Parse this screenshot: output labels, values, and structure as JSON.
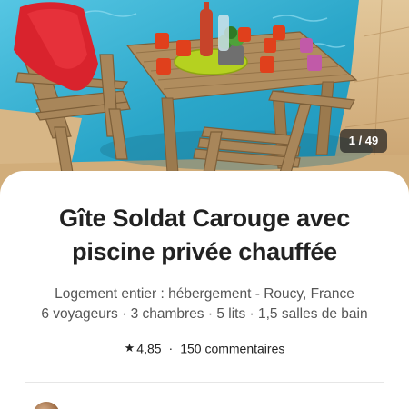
{
  "gallery": {
    "counter": "1 / 49",
    "photo_icon": "patio-photo"
  },
  "listing": {
    "title_line1": "Gîte Soldat Carouge avec",
    "title_line2": "piscine privée chauffée",
    "subtitle_line1": "Logement entier : hébergement - Roucy, France",
    "subtitle_line2": "6 voyageurs · 3 chambres · 5 lits · 1,5 salles de bain",
    "rating": "4,85",
    "separator": "·",
    "reviews": "150 commentaires",
    "star_icon": "star-icon"
  },
  "colors": {
    "pool": "#2aa6c9",
    "wood": "#a8865a",
    "text": "#222222",
    "muted": "#555555"
  }
}
